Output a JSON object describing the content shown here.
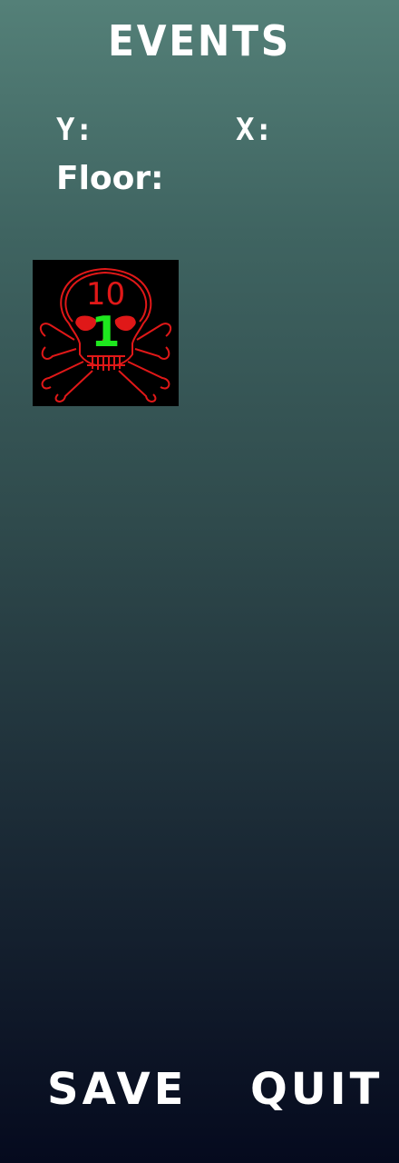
{
  "header": {
    "title": "EVENTS"
  },
  "position": {
    "y_label": "Y:",
    "y_value": "",
    "x_label": "X:",
    "x_value": "",
    "floor_label": "Floor:",
    "floor_value": ""
  },
  "events": [
    {
      "icon": "skull-crossbones-icon",
      "top_number": "10",
      "center_number": "1",
      "color": "#e01818",
      "number_color": "#1ee81e"
    }
  ],
  "buttons": {
    "save": "SAVE",
    "quit": "QUIT"
  }
}
